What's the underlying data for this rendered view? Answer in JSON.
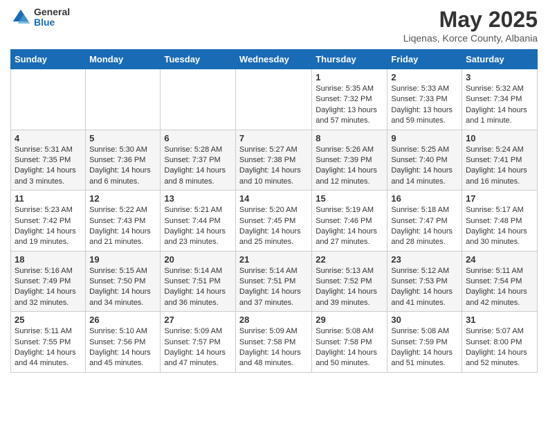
{
  "logo": {
    "general": "General",
    "blue": "Blue"
  },
  "title": "May 2025",
  "subtitle": "Liqenas, Korce County, Albania",
  "days_header": [
    "Sunday",
    "Monday",
    "Tuesday",
    "Wednesday",
    "Thursday",
    "Friday",
    "Saturday"
  ],
  "weeks": [
    [
      {
        "day": "",
        "content": ""
      },
      {
        "day": "",
        "content": ""
      },
      {
        "day": "",
        "content": ""
      },
      {
        "day": "",
        "content": ""
      },
      {
        "day": "1",
        "content": "Sunrise: 5:35 AM\nSunset: 7:32 PM\nDaylight: 13 hours and 57 minutes."
      },
      {
        "day": "2",
        "content": "Sunrise: 5:33 AM\nSunset: 7:33 PM\nDaylight: 13 hours and 59 minutes."
      },
      {
        "day": "3",
        "content": "Sunrise: 5:32 AM\nSunset: 7:34 PM\nDaylight: 14 hours and 1 minute."
      }
    ],
    [
      {
        "day": "4",
        "content": "Sunrise: 5:31 AM\nSunset: 7:35 PM\nDaylight: 14 hours and 3 minutes."
      },
      {
        "day": "5",
        "content": "Sunrise: 5:30 AM\nSunset: 7:36 PM\nDaylight: 14 hours and 6 minutes."
      },
      {
        "day": "6",
        "content": "Sunrise: 5:28 AM\nSunset: 7:37 PM\nDaylight: 14 hours and 8 minutes."
      },
      {
        "day": "7",
        "content": "Sunrise: 5:27 AM\nSunset: 7:38 PM\nDaylight: 14 hours and 10 minutes."
      },
      {
        "day": "8",
        "content": "Sunrise: 5:26 AM\nSunset: 7:39 PM\nDaylight: 14 hours and 12 minutes."
      },
      {
        "day": "9",
        "content": "Sunrise: 5:25 AM\nSunset: 7:40 PM\nDaylight: 14 hours and 14 minutes."
      },
      {
        "day": "10",
        "content": "Sunrise: 5:24 AM\nSunset: 7:41 PM\nDaylight: 14 hours and 16 minutes."
      }
    ],
    [
      {
        "day": "11",
        "content": "Sunrise: 5:23 AM\nSunset: 7:42 PM\nDaylight: 14 hours and 19 minutes."
      },
      {
        "day": "12",
        "content": "Sunrise: 5:22 AM\nSunset: 7:43 PM\nDaylight: 14 hours and 21 minutes."
      },
      {
        "day": "13",
        "content": "Sunrise: 5:21 AM\nSunset: 7:44 PM\nDaylight: 14 hours and 23 minutes."
      },
      {
        "day": "14",
        "content": "Sunrise: 5:20 AM\nSunset: 7:45 PM\nDaylight: 14 hours and 25 minutes."
      },
      {
        "day": "15",
        "content": "Sunrise: 5:19 AM\nSunset: 7:46 PM\nDaylight: 14 hours and 27 minutes."
      },
      {
        "day": "16",
        "content": "Sunrise: 5:18 AM\nSunset: 7:47 PM\nDaylight: 14 hours and 28 minutes."
      },
      {
        "day": "17",
        "content": "Sunrise: 5:17 AM\nSunset: 7:48 PM\nDaylight: 14 hours and 30 minutes."
      }
    ],
    [
      {
        "day": "18",
        "content": "Sunrise: 5:16 AM\nSunset: 7:49 PM\nDaylight: 14 hours and 32 minutes."
      },
      {
        "day": "19",
        "content": "Sunrise: 5:15 AM\nSunset: 7:50 PM\nDaylight: 14 hours and 34 minutes."
      },
      {
        "day": "20",
        "content": "Sunrise: 5:14 AM\nSunset: 7:51 PM\nDaylight: 14 hours and 36 minutes."
      },
      {
        "day": "21",
        "content": "Sunrise: 5:14 AM\nSunset: 7:51 PM\nDaylight: 14 hours and 37 minutes."
      },
      {
        "day": "22",
        "content": "Sunrise: 5:13 AM\nSunset: 7:52 PM\nDaylight: 14 hours and 39 minutes."
      },
      {
        "day": "23",
        "content": "Sunrise: 5:12 AM\nSunset: 7:53 PM\nDaylight: 14 hours and 41 minutes."
      },
      {
        "day": "24",
        "content": "Sunrise: 5:11 AM\nSunset: 7:54 PM\nDaylight: 14 hours and 42 minutes."
      }
    ],
    [
      {
        "day": "25",
        "content": "Sunrise: 5:11 AM\nSunset: 7:55 PM\nDaylight: 14 hours and 44 minutes."
      },
      {
        "day": "26",
        "content": "Sunrise: 5:10 AM\nSunset: 7:56 PM\nDaylight: 14 hours and 45 minutes."
      },
      {
        "day": "27",
        "content": "Sunrise: 5:09 AM\nSunset: 7:57 PM\nDaylight: 14 hours and 47 minutes."
      },
      {
        "day": "28",
        "content": "Sunrise: 5:09 AM\nSunset: 7:58 PM\nDaylight: 14 hours and 48 minutes."
      },
      {
        "day": "29",
        "content": "Sunrise: 5:08 AM\nSunset: 7:58 PM\nDaylight: 14 hours and 50 minutes."
      },
      {
        "day": "30",
        "content": "Sunrise: 5:08 AM\nSunset: 7:59 PM\nDaylight: 14 hours and 51 minutes."
      },
      {
        "day": "31",
        "content": "Sunrise: 5:07 AM\nSunset: 8:00 PM\nDaylight: 14 hours and 52 minutes."
      }
    ]
  ]
}
